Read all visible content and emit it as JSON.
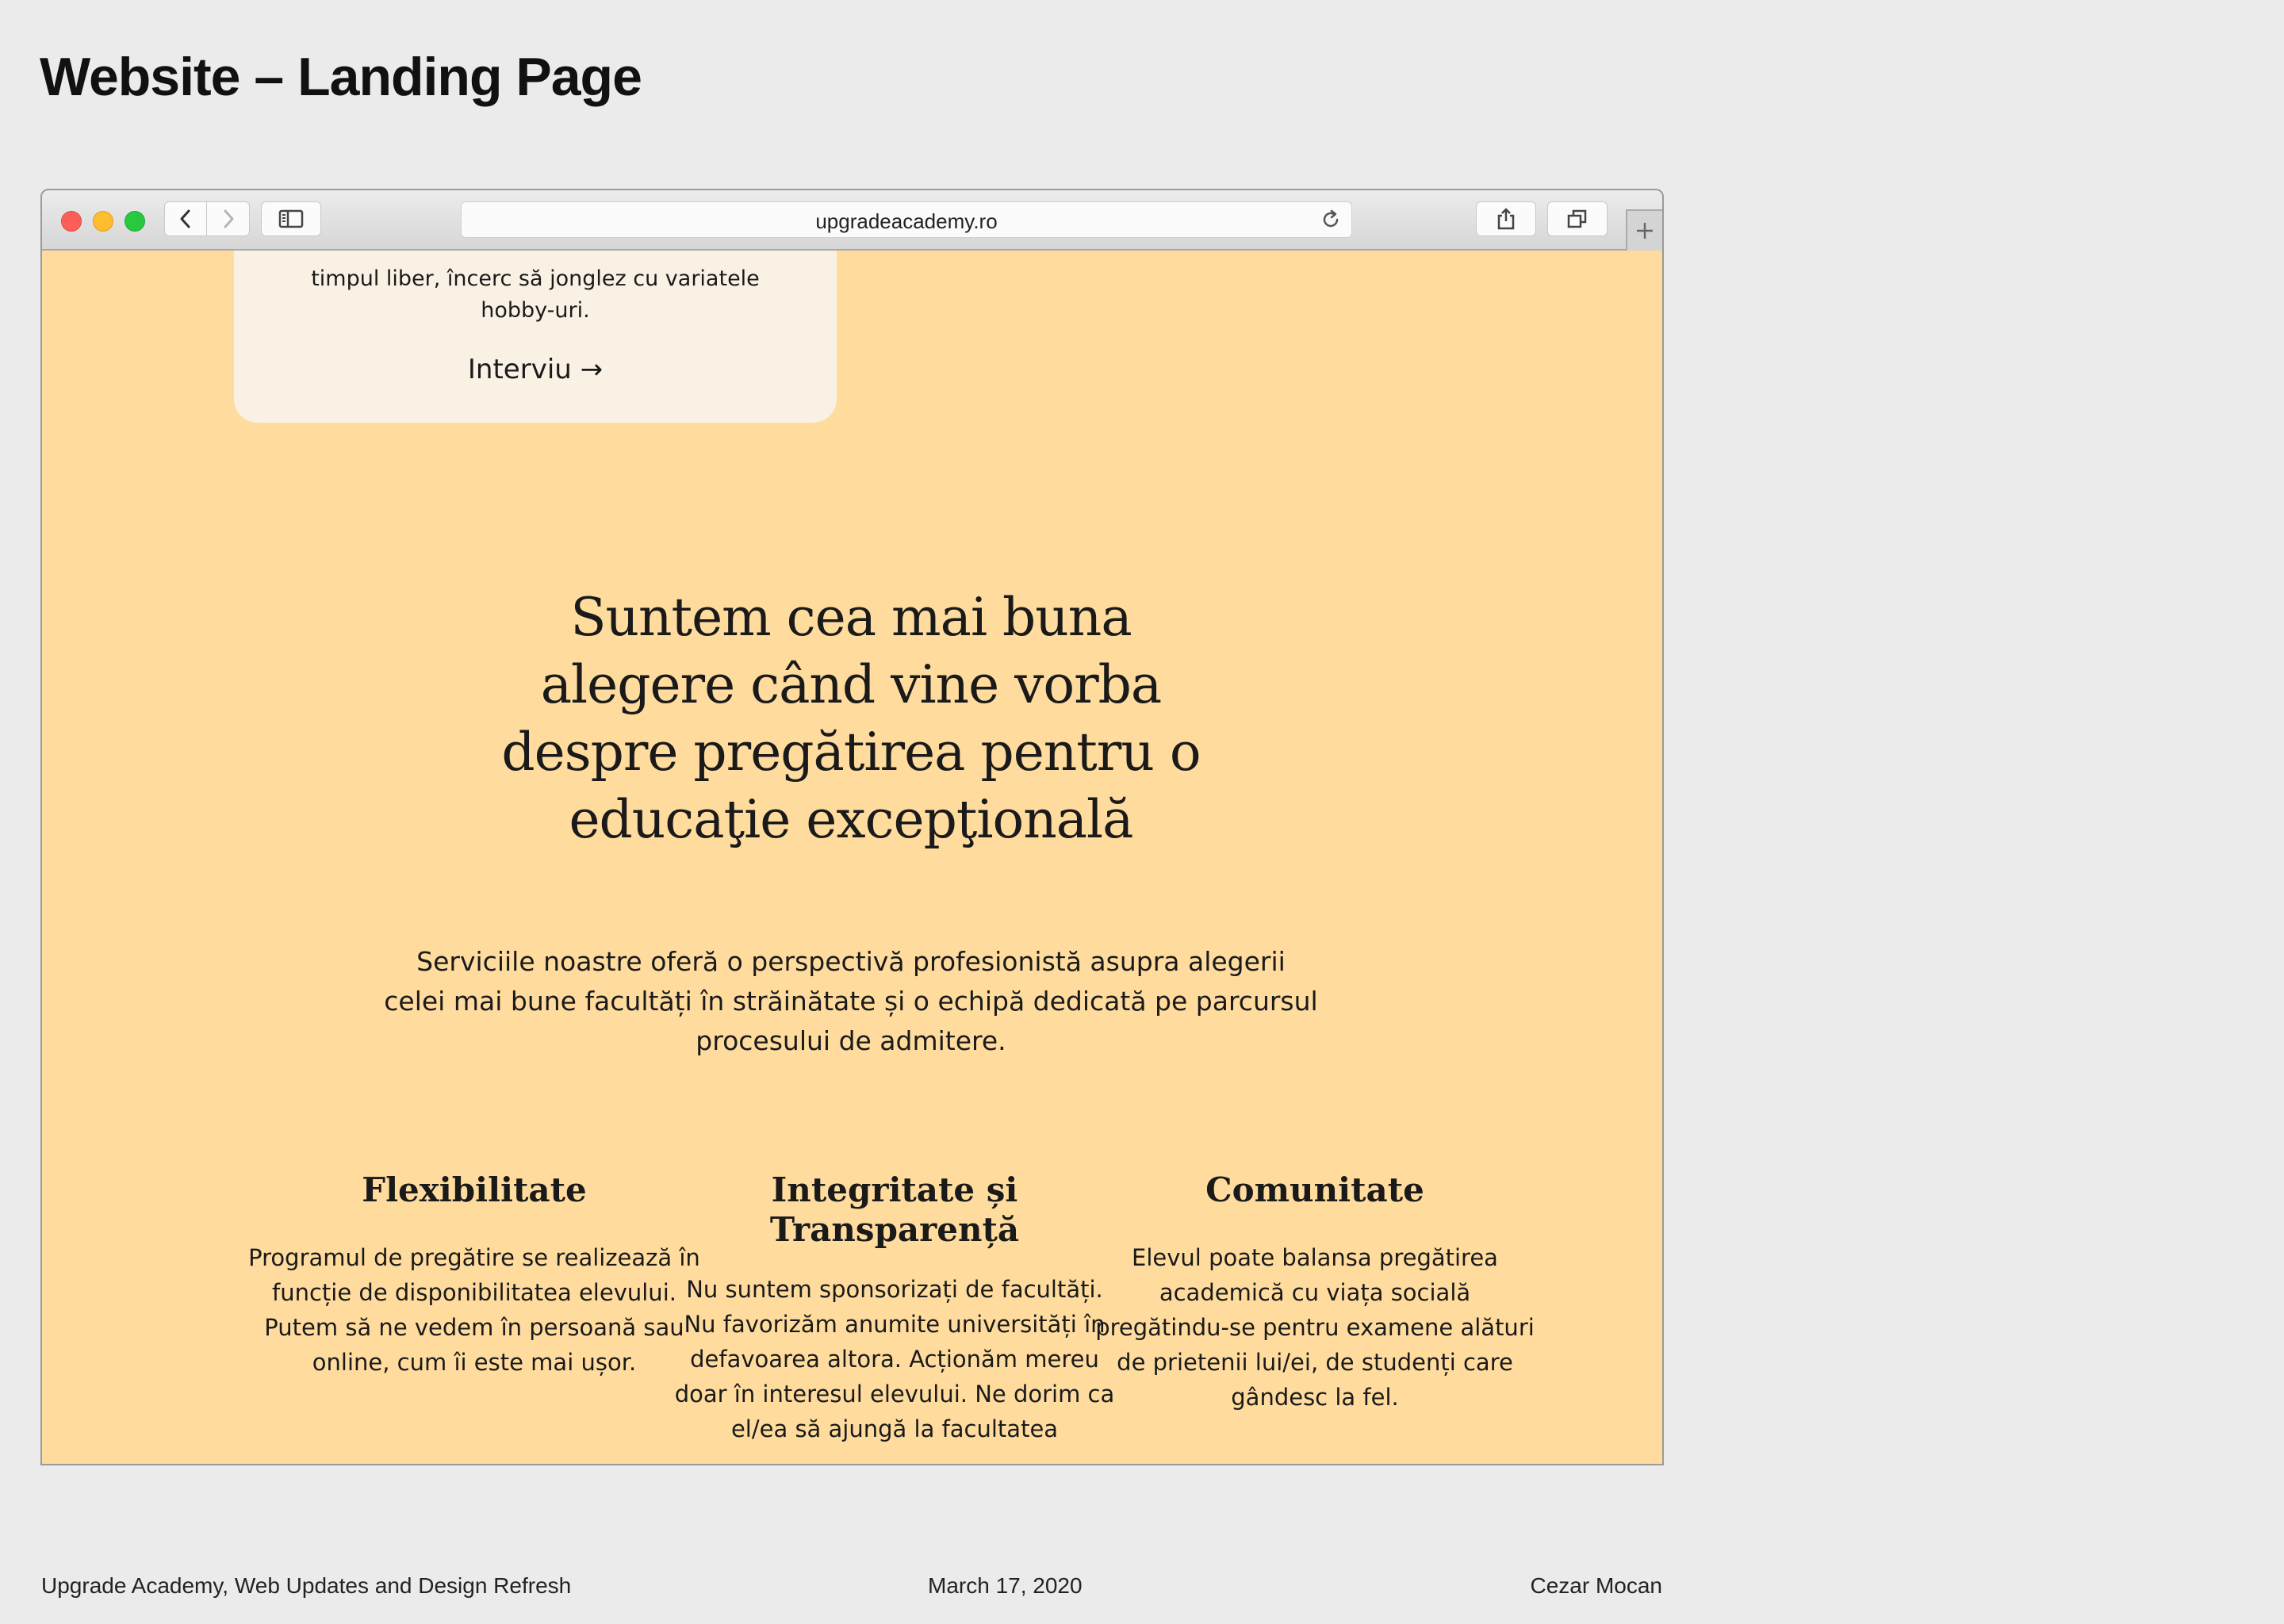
{
  "slide": {
    "title": "Website – Landing Page"
  },
  "browser": {
    "url": "upgradeacademy.ro"
  },
  "page": {
    "card": {
      "text": "timpul liber, încerc să jonglez cu variatele hobby-uri.",
      "link_label": "Interviu →"
    },
    "headline": "Suntem cea mai buna alegere când vine vorba despre pregătirea pentru o educaţie excepţională",
    "intro": "Serviciile noastre oferă o perspectivă profesionistă asupra alegerii celei mai bune facultăți în străinătate și o echipă dedicată pe parcursul procesului de admitere.",
    "features": [
      {
        "title": "Flexibilitate",
        "text": "Programul de pregătire se realizează în funcție de disponibilitatea elevului. Putem să ne vedem în persoană sau online, cum îi este mai ușor."
      },
      {
        "title": "Integritate și Transparență",
        "text": "Nu suntem sponsorizați de facultăți. Nu favorizăm anumite universități în defavoarea altora. Acționăm mereu doar în interesul elevului. Ne dorim ca el/ea să ajungă la facultatea"
      },
      {
        "title": "Comunitate",
        "text": "Elevul poate balansa pregătirea academică cu viața socială pregătindu-se pentru examene alături de prietenii lui/ei, de studenți care gândesc la fel."
      }
    ]
  },
  "footer": {
    "left": "Upgrade Academy, Web Updates and Design Refresh",
    "center": "March 17, 2020",
    "right": "Cezar Mocan"
  },
  "colors": {
    "page_background": "#ebebeb",
    "site_background": "#ffdc9e",
    "card_background": "#faf1e5"
  },
  "icons": [
    "close-icon",
    "minimize-icon",
    "zoom-icon",
    "back-icon",
    "forward-icon",
    "sidebar-icon",
    "reload-icon",
    "share-icon",
    "tabs-icon",
    "plus-icon"
  ]
}
